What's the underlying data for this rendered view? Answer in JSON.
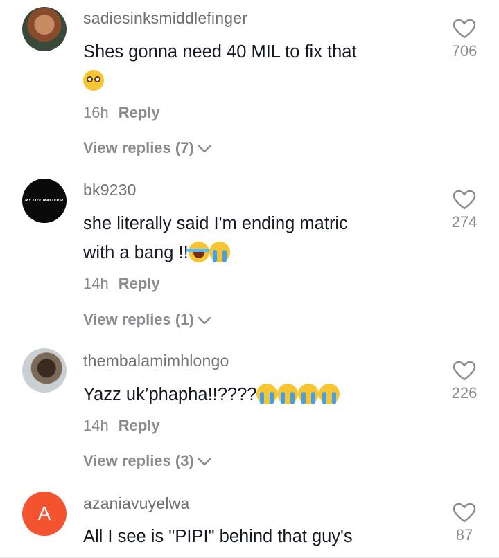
{
  "comments": [
    {
      "username": "sadiesinksmiddlefinger",
      "text_line1": "Shes gonna need 40 MIL to fix that",
      "emojis": [
        "flushed-face-emoji"
      ],
      "time": "16h",
      "reply_label": "Reply",
      "view_replies": "View replies (7)",
      "likes": "706",
      "avatar": "photo"
    },
    {
      "username": "bk9230",
      "text_line1": "she literally said I'm ending matric",
      "text_line2": "with a bang !!",
      "emojis": [
        "tears-of-joy-emoji",
        "loudly-crying-emoji"
      ],
      "time": "14h",
      "reply_label": "Reply",
      "view_replies": "View replies (1)",
      "likes": "274",
      "avatar_text": "MY LIFE MATTERS!"
    },
    {
      "username": "thembalamimhlongo",
      "text_line1": "Yazz uk’phapha!!????",
      "emojis": [
        "loudly-crying-emoji",
        "loudly-crying-emoji",
        "loudly-crying-emoji",
        "loudly-crying-emoji"
      ],
      "time": "14h",
      "reply_label": "Reply",
      "view_replies": "View replies (3)",
      "likes": "226",
      "avatar": "photo"
    },
    {
      "username": "azaniavuyelwa",
      "text_line1": "All I see is \"PIPI\" behind that guy's",
      "likes": "87",
      "avatar_letter": "A"
    }
  ],
  "colors": {
    "username": "#6f7075",
    "text": "#161823",
    "meta": "#8a8b91",
    "avatar_letter_bg": "#f4532f"
  }
}
